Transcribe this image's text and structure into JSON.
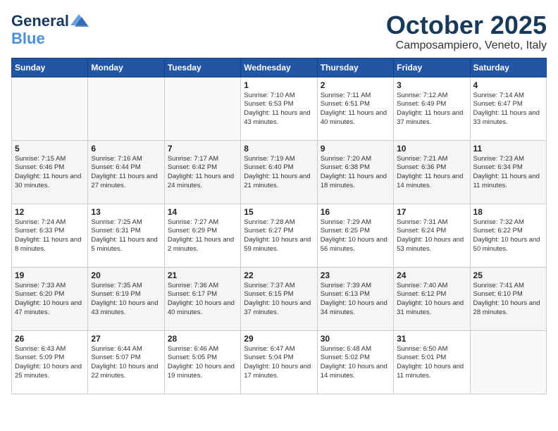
{
  "header": {
    "logo_line1": "General",
    "logo_line2": "Blue",
    "month": "October 2025",
    "location": "Camposampiero, Veneto, Italy"
  },
  "days_of_week": [
    "Sunday",
    "Monday",
    "Tuesday",
    "Wednesday",
    "Thursday",
    "Friday",
    "Saturday"
  ],
  "weeks": [
    [
      {
        "day": "",
        "content": ""
      },
      {
        "day": "",
        "content": ""
      },
      {
        "day": "",
        "content": ""
      },
      {
        "day": "1",
        "content": "Sunrise: 7:10 AM\nSunset: 6:53 PM\nDaylight: 11 hours and 43 minutes."
      },
      {
        "day": "2",
        "content": "Sunrise: 7:11 AM\nSunset: 6:51 PM\nDaylight: 11 hours and 40 minutes."
      },
      {
        "day": "3",
        "content": "Sunrise: 7:12 AM\nSunset: 6:49 PM\nDaylight: 11 hours and 37 minutes."
      },
      {
        "day": "4",
        "content": "Sunrise: 7:14 AM\nSunset: 6:47 PM\nDaylight: 11 hours and 33 minutes."
      }
    ],
    [
      {
        "day": "5",
        "content": "Sunrise: 7:15 AM\nSunset: 6:46 PM\nDaylight: 11 hours and 30 minutes."
      },
      {
        "day": "6",
        "content": "Sunrise: 7:16 AM\nSunset: 6:44 PM\nDaylight: 11 hours and 27 minutes."
      },
      {
        "day": "7",
        "content": "Sunrise: 7:17 AM\nSunset: 6:42 PM\nDaylight: 11 hours and 24 minutes."
      },
      {
        "day": "8",
        "content": "Sunrise: 7:19 AM\nSunset: 6:40 PM\nDaylight: 11 hours and 21 minutes."
      },
      {
        "day": "9",
        "content": "Sunrise: 7:20 AM\nSunset: 6:38 PM\nDaylight: 11 hours and 18 minutes."
      },
      {
        "day": "10",
        "content": "Sunrise: 7:21 AM\nSunset: 6:36 PM\nDaylight: 11 hours and 14 minutes."
      },
      {
        "day": "11",
        "content": "Sunrise: 7:23 AM\nSunset: 6:34 PM\nDaylight: 11 hours and 11 minutes."
      }
    ],
    [
      {
        "day": "12",
        "content": "Sunrise: 7:24 AM\nSunset: 6:33 PM\nDaylight: 11 hours and 8 minutes."
      },
      {
        "day": "13",
        "content": "Sunrise: 7:25 AM\nSunset: 6:31 PM\nDaylight: 11 hours and 5 minutes."
      },
      {
        "day": "14",
        "content": "Sunrise: 7:27 AM\nSunset: 6:29 PM\nDaylight: 11 hours and 2 minutes."
      },
      {
        "day": "15",
        "content": "Sunrise: 7:28 AM\nSunset: 6:27 PM\nDaylight: 10 hours and 59 minutes."
      },
      {
        "day": "16",
        "content": "Sunrise: 7:29 AM\nSunset: 6:25 PM\nDaylight: 10 hours and 56 minutes."
      },
      {
        "day": "17",
        "content": "Sunrise: 7:31 AM\nSunset: 6:24 PM\nDaylight: 10 hours and 53 minutes."
      },
      {
        "day": "18",
        "content": "Sunrise: 7:32 AM\nSunset: 6:22 PM\nDaylight: 10 hours and 50 minutes."
      }
    ],
    [
      {
        "day": "19",
        "content": "Sunrise: 7:33 AM\nSunset: 6:20 PM\nDaylight: 10 hours and 47 minutes."
      },
      {
        "day": "20",
        "content": "Sunrise: 7:35 AM\nSunset: 6:19 PM\nDaylight: 10 hours and 43 minutes."
      },
      {
        "day": "21",
        "content": "Sunrise: 7:36 AM\nSunset: 6:17 PM\nDaylight: 10 hours and 40 minutes."
      },
      {
        "day": "22",
        "content": "Sunrise: 7:37 AM\nSunset: 6:15 PM\nDaylight: 10 hours and 37 minutes."
      },
      {
        "day": "23",
        "content": "Sunrise: 7:39 AM\nSunset: 6:13 PM\nDaylight: 10 hours and 34 minutes."
      },
      {
        "day": "24",
        "content": "Sunrise: 7:40 AM\nSunset: 6:12 PM\nDaylight: 10 hours and 31 minutes."
      },
      {
        "day": "25",
        "content": "Sunrise: 7:41 AM\nSunset: 6:10 PM\nDaylight: 10 hours and 28 minutes."
      }
    ],
    [
      {
        "day": "26",
        "content": "Sunrise: 6:43 AM\nSunset: 5:09 PM\nDaylight: 10 hours and 25 minutes."
      },
      {
        "day": "27",
        "content": "Sunrise: 6:44 AM\nSunset: 5:07 PM\nDaylight: 10 hours and 22 minutes."
      },
      {
        "day": "28",
        "content": "Sunrise: 6:46 AM\nSunset: 5:05 PM\nDaylight: 10 hours and 19 minutes."
      },
      {
        "day": "29",
        "content": "Sunrise: 6:47 AM\nSunset: 5:04 PM\nDaylight: 10 hours and 17 minutes."
      },
      {
        "day": "30",
        "content": "Sunrise: 6:48 AM\nSunset: 5:02 PM\nDaylight: 10 hours and 14 minutes."
      },
      {
        "day": "31",
        "content": "Sunrise: 6:50 AM\nSunset: 5:01 PM\nDaylight: 10 hours and 11 minutes."
      },
      {
        "day": "",
        "content": ""
      }
    ]
  ]
}
